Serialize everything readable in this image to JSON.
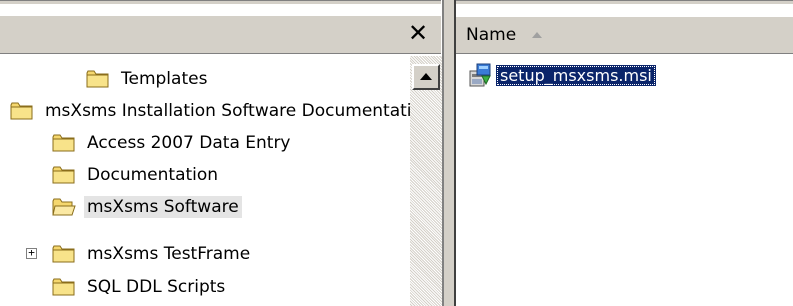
{
  "left_pane": {
    "close_symbol": "✕",
    "tree": [
      {
        "label": "Templates",
        "icon": "folder-icon"
      },
      {
        "label": "msXsms Installation Software Documentation",
        "icon": "folder-icon"
      },
      {
        "label": "Access 2007 Data Entry",
        "icon": "folder-icon"
      },
      {
        "label": "Documentation",
        "icon": "folder-icon"
      },
      {
        "label": "msXsms Software",
        "icon": "folder-open-icon",
        "highlighted": true
      },
      {
        "label": "msXsms TestFrame",
        "icon": "folder-icon",
        "expander": "+"
      },
      {
        "label": "SQL DDL Scripts",
        "icon": "folder-icon"
      }
    ]
  },
  "right_pane": {
    "column_name": "Name",
    "files": [
      {
        "label": "setup_msxsms.msi",
        "icon": "msi-installer-icon",
        "selected": true
      }
    ]
  },
  "colors": {
    "chrome": "#d4d0c8",
    "selection": "#0a246a",
    "folder_yellow": "#f5d76e",
    "folder_outline": "#8a6d1b"
  }
}
